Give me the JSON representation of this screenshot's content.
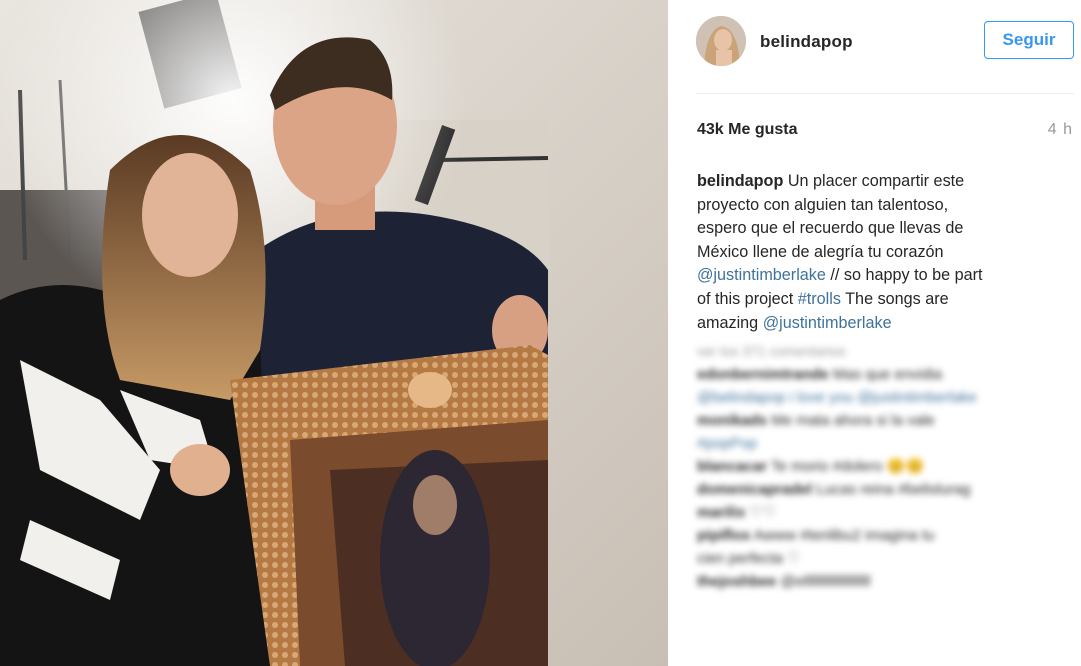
{
  "post": {
    "username": "belindapop",
    "follow_label": "Seguir",
    "likes": "43k Me gusta",
    "time": "4 h"
  },
  "caption": {
    "username": "belindapop",
    "lines": [
      " Un placer compartir este",
      "proyecto con alguien tan talentoso,",
      "espero que el recuerdo que llevas de",
      "México llene de alegría tu corazón"
    ],
    "mention1": "@justintimberlake",
    "line5_rest": " // so happy to be part",
    "line6_pre": "of this project ",
    "hashtag": "#trolls",
    "line6_post": " The songs are",
    "line7_pre": "amazing ",
    "mention2": "@justintimberlake"
  },
  "comments": {
    "more_label": "ver los 371 comentarios",
    "items": [
      {
        "user": "edonbernimtrande",
        "text": " Mas que envidia"
      },
      {
        "user": "",
        "text": "@belindapop i love you @justintimberlake"
      },
      {
        "user": "monikads",
        "text": " Me mata ahora si la vale"
      },
      {
        "user": "",
        "text": "#popPop"
      },
      {
        "user": "blancacar",
        "text": " Te morio #dolero 😊😊"
      },
      {
        "user": "domenicapradel",
        "text": " Lucas reina #belislurag"
      },
      {
        "user": "marilix",
        "text": " ♡♡"
      },
      {
        "user": "pipiflox",
        "text": " Awww #tenlibu2 imagina tu"
      },
      {
        "user": "",
        "text": "cien perfecta ♡"
      },
      {
        "user": "thejoshbee",
        "text": " @ellllllllllllllllllll"
      }
    ]
  }
}
